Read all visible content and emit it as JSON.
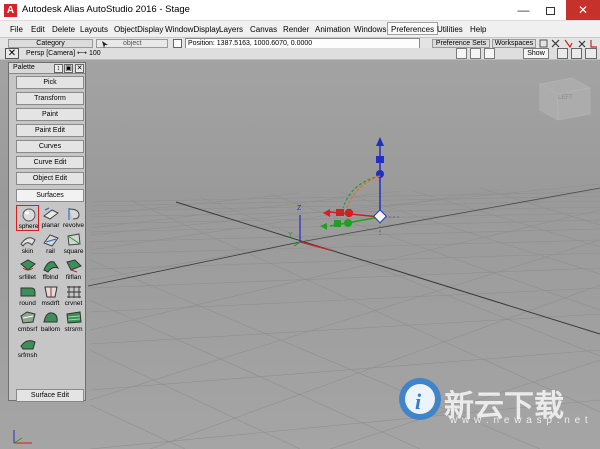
{
  "window": {
    "app_icon": "A",
    "title": "Autodesk Alias AutoStudio 2016   - Stage",
    "minimize": "—",
    "close": "✕"
  },
  "menu": [
    {
      "label": "File"
    },
    {
      "label": "Edit"
    },
    {
      "label": "Delete"
    },
    {
      "label": "Layouts"
    },
    {
      "label": "ObjectDisplay"
    },
    {
      "label": "WindowDisplay"
    },
    {
      "label": "Layers"
    },
    {
      "label": "Canvas"
    },
    {
      "label": "Render"
    },
    {
      "label": "Animation"
    },
    {
      "label": "Windows"
    },
    {
      "label": "Preferences",
      "active": true
    },
    {
      "label": "Utilities"
    },
    {
      "label": "Help"
    }
  ],
  "toolbar": {
    "category": "Category",
    "object": "object",
    "position": "Position:  1387.5163, 1000.6070, 0.0000",
    "preference_sets": "Preference Sets",
    "workspaces": "Workspaces"
  },
  "viewport": {
    "camera": "Persp [Camera]",
    "zoom": "100",
    "show": "Show",
    "view_cube": "LEFT",
    "axis_y": "Y",
    "axis_z": "Z"
  },
  "palette": {
    "title": "Palette",
    "sections": [
      "Pick",
      "Transform",
      "Paint",
      "Paint Edit",
      "Curves",
      "Curve Edit",
      "Object Edit"
    ],
    "open_section": "Surfaces",
    "tools": [
      "sphere",
      "planar",
      "revolve",
      "skin",
      "rail",
      "square",
      "srfillet",
      "ffblnd",
      "filflan",
      "round",
      "msdrft",
      "crvnet",
      "cmbsrf",
      "ballom",
      "strsrm",
      "srfmsh"
    ],
    "footer_section": "Surface Edit"
  },
  "watermark": {
    "text": "新云下载",
    "url": "w w w . n e w a s p . n e t"
  },
  "colors": {
    "viewport_bg": "#9e9e9e",
    "grid_line": "#8a8a8a",
    "axis_x": "#d02020",
    "axis_y": "#20a020",
    "axis_z": "#2030c0"
  }
}
